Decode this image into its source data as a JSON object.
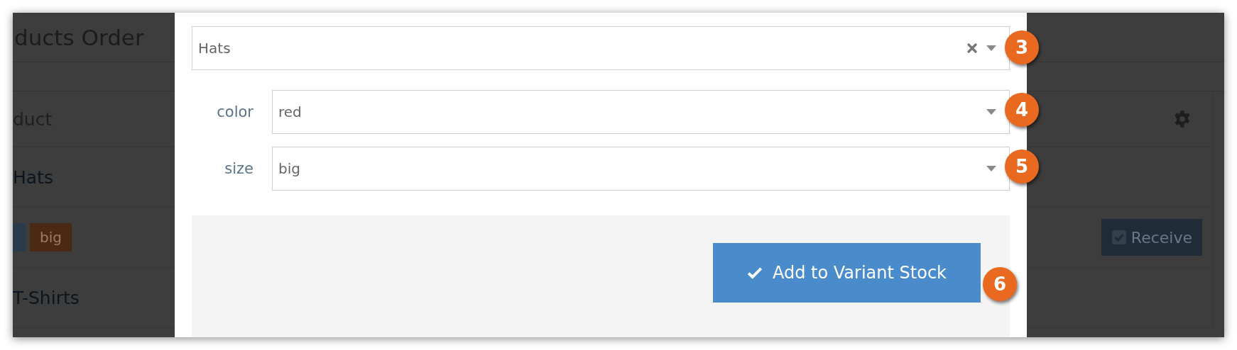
{
  "background_page": {
    "title": "ducts Order",
    "table": {
      "header": "duct",
      "rows": [
        {
          "kind": "product",
          "text": "Hats"
        },
        {
          "kind": "tags",
          "tags": [
            {
              "color": "#2c3b4c"
            },
            {
              "label": "big",
              "color": "#4a2a15"
            }
          ],
          "button": "Receive"
        },
        {
          "kind": "product",
          "text": "T-Shirts"
        }
      ]
    }
  },
  "modal": {
    "fields": [
      {
        "kind": "select",
        "value": "Hats",
        "clearable": true,
        "step": "3"
      },
      {
        "kind": "labeled",
        "label": "color",
        "value": "red",
        "clearable": false,
        "step": "4"
      },
      {
        "kind": "labeled",
        "label": "size",
        "value": "big",
        "clearable": false,
        "step": "5"
      }
    ],
    "button": {
      "label": "Add to Variant Stock",
      "step": "6"
    }
  }
}
